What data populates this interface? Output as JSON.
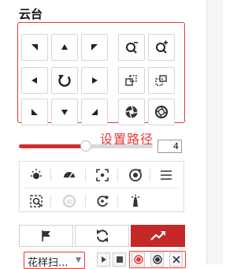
{
  "ptz": {
    "title": "云台"
  },
  "annotation": {
    "text": "设置路径"
  },
  "speed": {
    "value": "4",
    "level_fraction": 0.5
  },
  "tabs": [
    {
      "name": "preset",
      "icon": "flag-icon",
      "active": false
    },
    {
      "name": "patrol",
      "icon": "refresh-cycle-icon",
      "active": false
    },
    {
      "name": "pattern",
      "icon": "trend-arrow-icon",
      "active": true
    }
  ],
  "path": {
    "selected": "花样扫..."
  },
  "colors": {
    "accent": "#c62828",
    "annotation": "#e53935",
    "border": "#d6d6d6"
  }
}
